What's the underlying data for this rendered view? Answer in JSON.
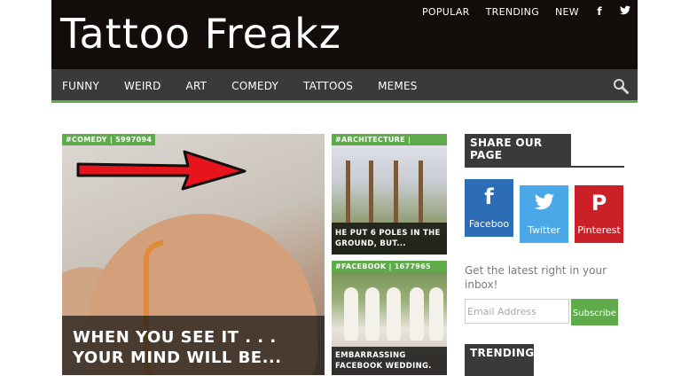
{
  "site": {
    "logo": "Tattoo Freakz"
  },
  "topnav": {
    "links": [
      "POPULAR",
      "TRENDING",
      "NEW"
    ],
    "facebook_icon": "f",
    "twitter_icon": "twitter-bird"
  },
  "mainnav": {
    "items": [
      "FUNNY",
      "WEIRD",
      "ART",
      "COMEDY",
      "TATTOOS",
      "MEMES"
    ],
    "search_icon": "search-icon"
  },
  "featured": {
    "tag": "#COMEDY | 5997094",
    "title": "WHEN YOU SEE IT . . . YOUR MIND WILL BE..."
  },
  "cards": [
    {
      "tag": "#ARCHITECTURE |",
      "caption": "HE PUT 6 POLES IN THE GROUND, BUT..."
    },
    {
      "tag": "#FACEBOOK | 1677965",
      "caption": "EMBARRASSING FACEBOOK WEDDING."
    }
  ],
  "sidebar": {
    "share_title": "SHARE OUR PAGE",
    "share_buttons": [
      {
        "icon": "f",
        "label": "Faceboo"
      },
      {
        "icon": "twitter-bird",
        "label": "Twitter"
      },
      {
        "icon": "P",
        "label": "Pinterest"
      }
    ],
    "latest_text": "Get the latest right in your inbox!",
    "email_placeholder": "Email Address",
    "subscribe_label": "Subscribe",
    "trending_title": "TRENDING"
  },
  "colors": {
    "header_bg": "#120c0a",
    "nav_bg": "#3a3a3a",
    "accent_green": "#5faa4a",
    "facebook": "#2d6db5",
    "twitter": "#4aa8e8",
    "pinterest": "#cb2027"
  }
}
